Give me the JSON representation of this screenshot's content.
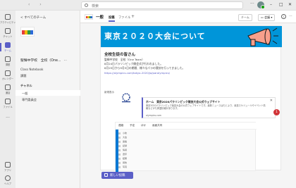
{
  "titlebar": {
    "search_placeholder": "検索"
  },
  "rail": [
    {
      "label": "アクティビティ"
    },
    {
      "label": "チャット"
    },
    {
      "label": "チーム"
    },
    {
      "label": "課題"
    },
    {
      "label": "カレンダー"
    },
    {
      "label": "通話"
    },
    {
      "label": "ファイル"
    },
    {
      "label": "..."
    },
    {
      "label": "アプリ"
    },
    {
      "label": "ヘルプ"
    }
  ],
  "sidebar": {
    "back_label": "< すべてのチーム",
    "team_name": "聖輝中学校　全校（One...",
    "links": [
      "Class Notebook",
      "課題"
    ],
    "channels_heading": "チャネル",
    "channels": [
      "一般",
      "専門委員会"
    ]
  },
  "header": {
    "channel_title": "一般",
    "tabs": [
      "投稿",
      "ファイル",
      "+"
    ],
    "team_button": "チーム",
    "meet_button": "会議",
    "info_icon": "i",
    "more_icon": "..."
  },
  "post": {
    "banner_title": "東京２０２０大会について",
    "title": "全校生徒の皆さん",
    "lines": [
      "聖輝中学校　全校（One Team）",
      "8月24日パラリンピック開会式が行われました。",
      "8月25日から9月5日の期間、様々なパラの競技を行ってきました。"
    ],
    "link": "https://olympics.com/tokyo-2020/ja/paralympics/",
    "tag": "新規表示",
    "preview": {
      "title": "ホーム　東京2020パラリンピック競技大会公式ウェブサイト",
      "description": "東京2020パラリンピック競技大会の公式ウェブサイトです。最新ニュースはもとより、競技スケジュールやイベント情報などがも掲載情報があります。",
      "domain": "olympics.com"
    },
    "doc_tabs": [
      "連絡",
      "予定",
      "ほか",
      "画面共有"
    ],
    "doc_rows": [
      "小枚",
      "大会",
      "連絡",
      "記録",
      "情報",
      "選手",
      "結果",
      "報告",
      "写真",
      "動画"
    ]
  },
  "notification_count": "1",
  "new_post_label": "新しい投稿"
}
